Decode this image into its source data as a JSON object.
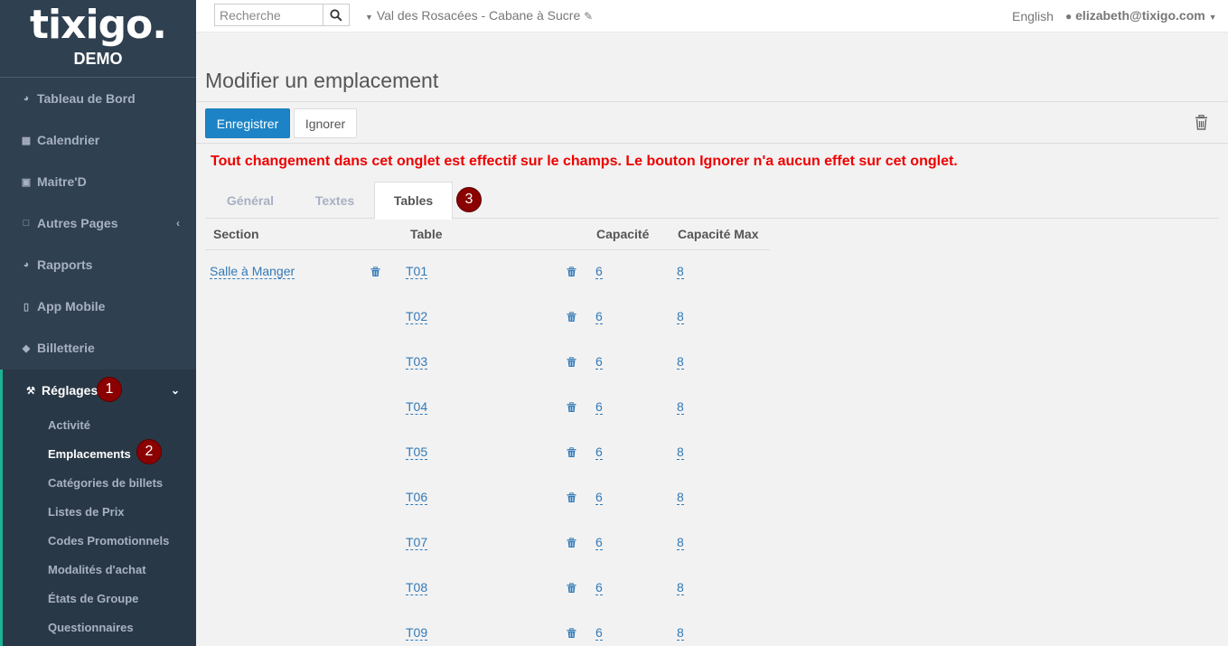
{
  "sidebar": {
    "brand": "tixigo.",
    "env": "DEMO",
    "items": [
      {
        "label": "Tableau de Bord",
        "icon": "dashboard-icon"
      },
      {
        "label": "Calendrier",
        "icon": "calendar-icon"
      },
      {
        "label": "Maitre'D",
        "icon": "badge-icon"
      },
      {
        "label": "Autres Pages",
        "icon": "file-icon"
      },
      {
        "label": "Rapports",
        "icon": "pie-chart-icon"
      },
      {
        "label": "App Mobile",
        "icon": "mobile-icon"
      },
      {
        "label": "Billetterie",
        "icon": "ticket-icon"
      },
      {
        "label": "Réglages",
        "icon": "wrench-icon"
      }
    ],
    "sub_items": [
      "Activité",
      "Emplacements",
      "Catégories de billets",
      "Listes de Prix",
      "Codes Promotionnels",
      "Modalités d'achat",
      "États de Groupe",
      "Questionnaires"
    ]
  },
  "annotations": [
    "1",
    "2",
    "3"
  ],
  "topbar": {
    "search_placeholder": "Recherche",
    "venue": "Val des Rosacées - Cabane à Sucre",
    "language": "English",
    "user": "elizabeth@tixigo.com"
  },
  "page": {
    "title": "Modifier un emplacement",
    "save_label": "Enregistrer",
    "ignore_label": "Ignorer",
    "warning": "Tout changement dans cet onglet est effectif sur le champs. Le bouton Ignorer n'a aucun effet sur cet onglet."
  },
  "tabs": [
    "Général",
    "Textes",
    "Tables"
  ],
  "table": {
    "headers": [
      "Section",
      "Table",
      "Capacité",
      "Capacité Max"
    ],
    "section": "Salle à Manger",
    "rows": [
      {
        "table": "T01",
        "capacity": "6",
        "max": "8"
      },
      {
        "table": "T02",
        "capacity": "6",
        "max": "8"
      },
      {
        "table": "T03",
        "capacity": "6",
        "max": "8"
      },
      {
        "table": "T04",
        "capacity": "6",
        "max": "8"
      },
      {
        "table": "T05",
        "capacity": "6",
        "max": "8"
      },
      {
        "table": "T06",
        "capacity": "6",
        "max": "8"
      },
      {
        "table": "T07",
        "capacity": "6",
        "max": "8"
      },
      {
        "table": "T08",
        "capacity": "6",
        "max": "8"
      },
      {
        "table": "T09",
        "capacity": "6",
        "max": "8"
      }
    ]
  }
}
